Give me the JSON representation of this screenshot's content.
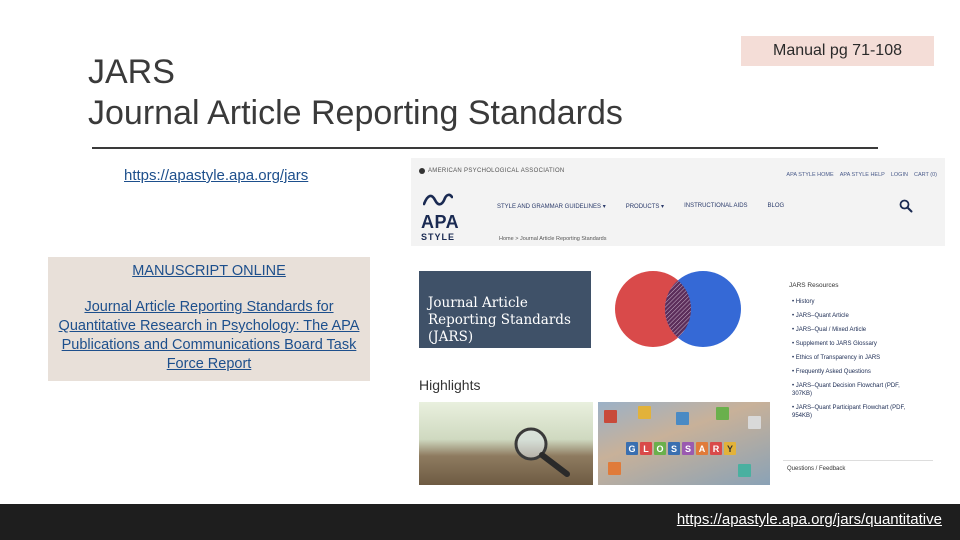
{
  "slide": {
    "title_line1": "JARS",
    "title_line2": "Journal Article Reporting Standards",
    "manual_ref": "Manual pg 71-108",
    "top_link": "https://apastyle.apa.org/jars",
    "bottom_link": "https://apastyle.apa.org/jars/quantitative"
  },
  "manuscript_box": {
    "title": "MANUSCRIPT ONLINE",
    "body": "Journal Article Reporting Standards for Quantitative Research in Psychology: The APA Publications and Communications Board Task Force Report"
  },
  "screenshot": {
    "org_name": "AMERICAN PSYCHOLOGICAL ASSOCIATION",
    "util_nav": [
      "APA STYLE HOME",
      "APA STYLE HELP",
      "LOGIN",
      "CART (0)"
    ],
    "logo_text": "APA",
    "logo_sub": "STYLE",
    "main_nav": [
      "STYLE AND GRAMMAR GUIDELINES",
      "PRODUCTS",
      "INSTRUCTIONAL AIDS",
      "BLOG"
    ],
    "breadcrumb": "Home > Journal Article Reporting Standards",
    "hero_text": "Journal Article Reporting Standards (JARS)",
    "highlights_heading": "Highlights",
    "glossary_letters": [
      "G",
      "L",
      "O",
      "S",
      "S",
      "A",
      "R",
      "Y"
    ],
    "resources_title": "JARS Resources",
    "resources": [
      "History",
      "JARS–Quant Article",
      "JARS–Qual / Mixed Article",
      "Supplement to JARS Glossary",
      "Ethics of Transparency in JARS",
      "Frequently Asked Questions",
      "JARS–Quant Decision Flowchart (PDF, 307KB)",
      "JARS–Quant Participant Flowchart (PDF, 954KB)"
    ],
    "questions_label": "Questions / Feedback"
  },
  "colors": {
    "link": "#1d4f8c",
    "badge_bg": "#f4ddd7",
    "box_bg": "#e8e0d9",
    "hero_bg": "#3f5168",
    "venn_red": "#d94a4a",
    "venn_blue": "#3569d6",
    "bottom_bar": "#1e1e1e"
  }
}
